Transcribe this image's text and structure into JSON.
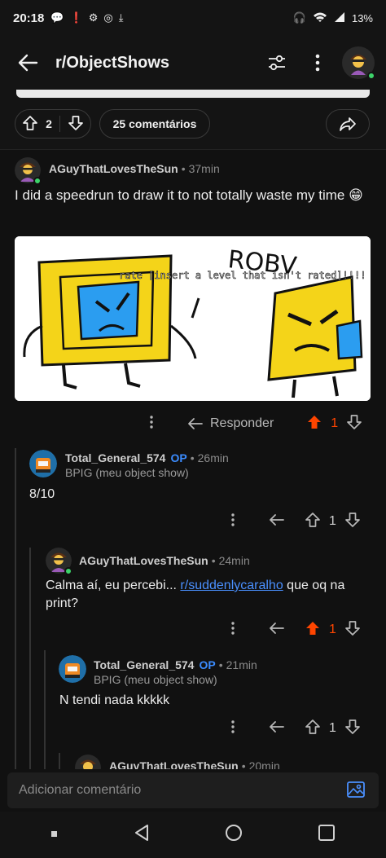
{
  "status_bar": {
    "time": "20:18",
    "battery": "13%"
  },
  "app_bar": {
    "title": "r/ObjectShows"
  },
  "post_actions": {
    "votes": "2",
    "comments_label": "25 comentários"
  },
  "comments": [
    {
      "username": "AGuyThatLovesTheSun",
      "age": "37min",
      "text": "I did a speedrun to draw it to not totally waste my time 😁",
      "image_text": {
        "heading": "ROBV",
        "caption": "rate [insert a level that isn't rated]!!!!"
      },
      "reply_label": "Responder",
      "votes": "1",
      "upvoted": true
    },
    {
      "username": "Total_General_574",
      "op_tag": "OP",
      "age": "26min",
      "flair": "BPIG (meu object show)",
      "text": "8/10",
      "votes": "1",
      "upvoted": false
    },
    {
      "username": "AGuyThatLovesTheSun",
      "age": "24min",
      "text_before": "Calma aí, eu percebi... ",
      "link": "r/suddenlycaralho",
      "text_after": " que oq na print?",
      "votes": "1",
      "upvoted": true
    },
    {
      "username": "Total_General_574",
      "op_tag": "OP",
      "age": "21min",
      "flair": "BPIG (meu object show)",
      "text": "N tendi nada kkkkk",
      "votes": "1",
      "upvoted": false
    },
    {
      "username": "AGuyThatLovesTheSun",
      "age": "20min"
    }
  ],
  "composer": {
    "placeholder": "Adicionar comentário"
  },
  "colors": {
    "background": "#111111",
    "upvote_orange": "#ff4500",
    "op_blue": "#3b8cff",
    "link_blue": "#4a90ff",
    "online_green": "#3dd36a"
  },
  "icons": [
    "back-arrow-icon",
    "sort-options-icon",
    "more-vertical-icon",
    "upvote-icon",
    "downvote-icon",
    "share-icon",
    "reply-icon",
    "image-upload-icon",
    "nav-recents-icon",
    "nav-back-icon",
    "nav-home-icon",
    "nav-overview-icon"
  ]
}
